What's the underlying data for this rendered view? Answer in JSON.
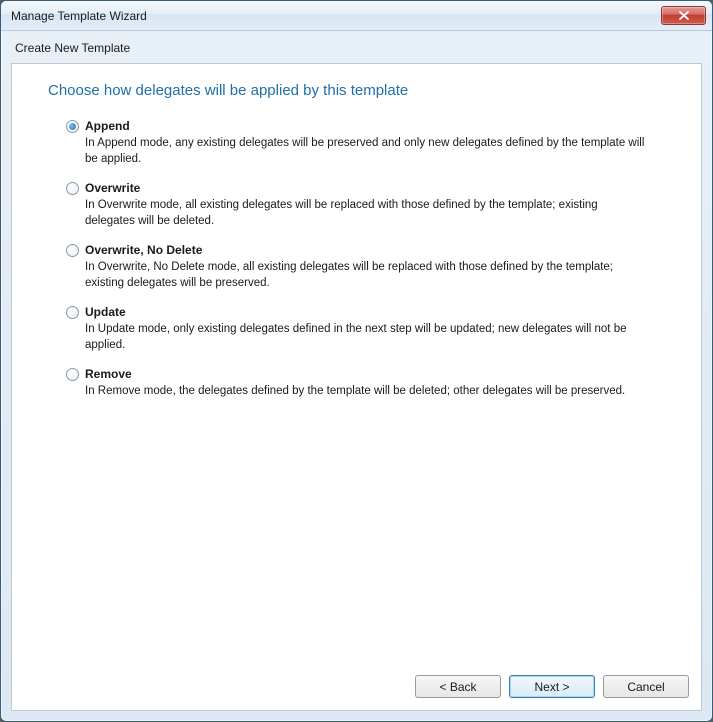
{
  "window": {
    "title": "Manage Template Wizard",
    "subtitle": "Create New Template"
  },
  "page": {
    "heading": "Choose how delegates will be applied by this template"
  },
  "options": [
    {
      "label": "Append",
      "description": "In Append mode, any existing delegates will be preserved and only new delegates defined by the template will be applied.",
      "selected": true
    },
    {
      "label": "Overwrite",
      "description": "In Overwrite mode, all existing delegates will be replaced with those defined by the template; existing delegates will be deleted.",
      "selected": false
    },
    {
      "label": "Overwrite, No Delete",
      "description": "In Overwrite, No Delete mode, all existing delegates will be replaced with those defined by the template; existing delegates will be preserved.",
      "selected": false
    },
    {
      "label": "Update",
      "description": "In Update mode, only existing delegates defined in the next step will be updated; new delegates will not be applied.",
      "selected": false
    },
    {
      "label": "Remove",
      "description": "In Remove mode, the delegates defined by the template will be deleted; other delegates will be preserved.",
      "selected": false
    }
  ],
  "buttons": {
    "back": "< Back",
    "next": "Next >",
    "cancel": "Cancel"
  }
}
